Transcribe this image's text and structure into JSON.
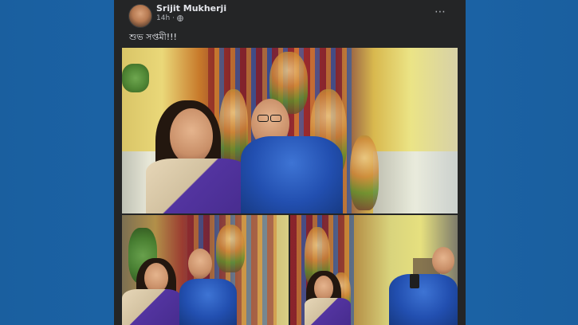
{
  "post": {
    "author": "Srijit Mukherji",
    "time": "14h",
    "separator": "·",
    "caption": "শুভ সপ্তমী!!!"
  },
  "icons": {
    "more": "⋯",
    "globe": "globe-icon"
  },
  "colors": {
    "page_bg": "#1b63a6",
    "card_bg": "#242526",
    "text_primary": "#e4e6eb",
    "text_secondary": "#b0b3b8"
  }
}
